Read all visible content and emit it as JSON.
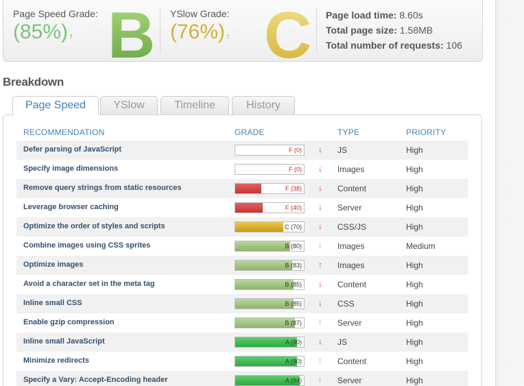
{
  "summary": {
    "pagespeed": {
      "label": "Page Speed Grade:",
      "percent": "(85%)",
      "trend_icon": "up-arrow-icon",
      "letter": "B",
      "color": "#86bd5a"
    },
    "yslow": {
      "label": "YSlow Grade:",
      "percent": "(76%)",
      "trend_icon": "up-down-arrow-icon",
      "letter": "C",
      "color": "#d3b233"
    },
    "stats": [
      {
        "label": "Page load time:",
        "value": "8.60s"
      },
      {
        "label": "Total page size:",
        "value": "1.58MB"
      },
      {
        "label": "Total number of requests:",
        "value": "106"
      }
    ]
  },
  "breakdown": {
    "title": "Breakdown",
    "tabs": [
      {
        "label": "Page Speed",
        "active": true
      },
      {
        "label": "YSlow",
        "active": false
      },
      {
        "label": "Timeline",
        "active": false
      },
      {
        "label": "History",
        "active": false
      }
    ],
    "columns": {
      "recommendation": "RECOMMENDATION",
      "grade": "GRADE",
      "type": "TYPE",
      "priority": "PRIORITY"
    },
    "rows": [
      {
        "recommendation": "Defer parsing of JavaScript",
        "grade": "F (0)",
        "score": 0,
        "color": "red",
        "trend": "down",
        "type": "JS",
        "priority": "High"
      },
      {
        "recommendation": "Specify image dimensions",
        "grade": "F (0)",
        "score": 0,
        "color": "red",
        "trend": "down",
        "type": "Images",
        "priority": "High"
      },
      {
        "recommendation": "Remove query strings from static resources",
        "grade": "F (38)",
        "score": 38,
        "color": "red",
        "trend": "down",
        "type": "Content",
        "priority": "High"
      },
      {
        "recommendation": "Leverage browser caching",
        "grade": "F (40)",
        "score": 40,
        "color": "red",
        "trend": "down",
        "type": "Server",
        "priority": "High"
      },
      {
        "recommendation": "Optimize the order of styles and scripts",
        "grade": "C (70)",
        "score": 70,
        "color": "yellow",
        "trend": "down",
        "type": "CSS/JS",
        "priority": "High"
      },
      {
        "recommendation": "Combine images using CSS sprites",
        "grade": "B (80)",
        "score": 80,
        "color": "lgreen",
        "trend": "both",
        "type": "Images",
        "priority": "Medium"
      },
      {
        "recommendation": "Optimize images",
        "grade": "B (83)",
        "score": 83,
        "color": "lgreen",
        "trend": "up",
        "type": "Images",
        "priority": "High"
      },
      {
        "recommendation": "Avoid a character set in the meta tag",
        "grade": "B (85)",
        "score": 85,
        "color": "lgreen",
        "trend": "down",
        "type": "Content",
        "priority": "High"
      },
      {
        "recommendation": "Inline small CSS",
        "grade": "B (85)",
        "score": 85,
        "color": "lgreen",
        "trend": "down",
        "type": "CSS",
        "priority": "High"
      },
      {
        "recommendation": "Enable gzip compression",
        "grade": "B (87)",
        "score": 87,
        "color": "lgreen",
        "trend": "both",
        "type": "Server",
        "priority": "High"
      },
      {
        "recommendation": "Inline small JavaScript",
        "grade": "A (90)",
        "score": 90,
        "color": "green",
        "trend": "down",
        "type": "JS",
        "priority": "High"
      },
      {
        "recommendation": "Minimize redirects",
        "grade": "A (90)",
        "score": 90,
        "color": "green",
        "trend": "both",
        "type": "Content",
        "priority": "High"
      },
      {
        "recommendation": "Specify a Vary: Accept-Encoding header",
        "grade": "A (94)",
        "score": 94,
        "color": "green",
        "trend": "both",
        "type": "Server",
        "priority": "High"
      }
    ]
  }
}
